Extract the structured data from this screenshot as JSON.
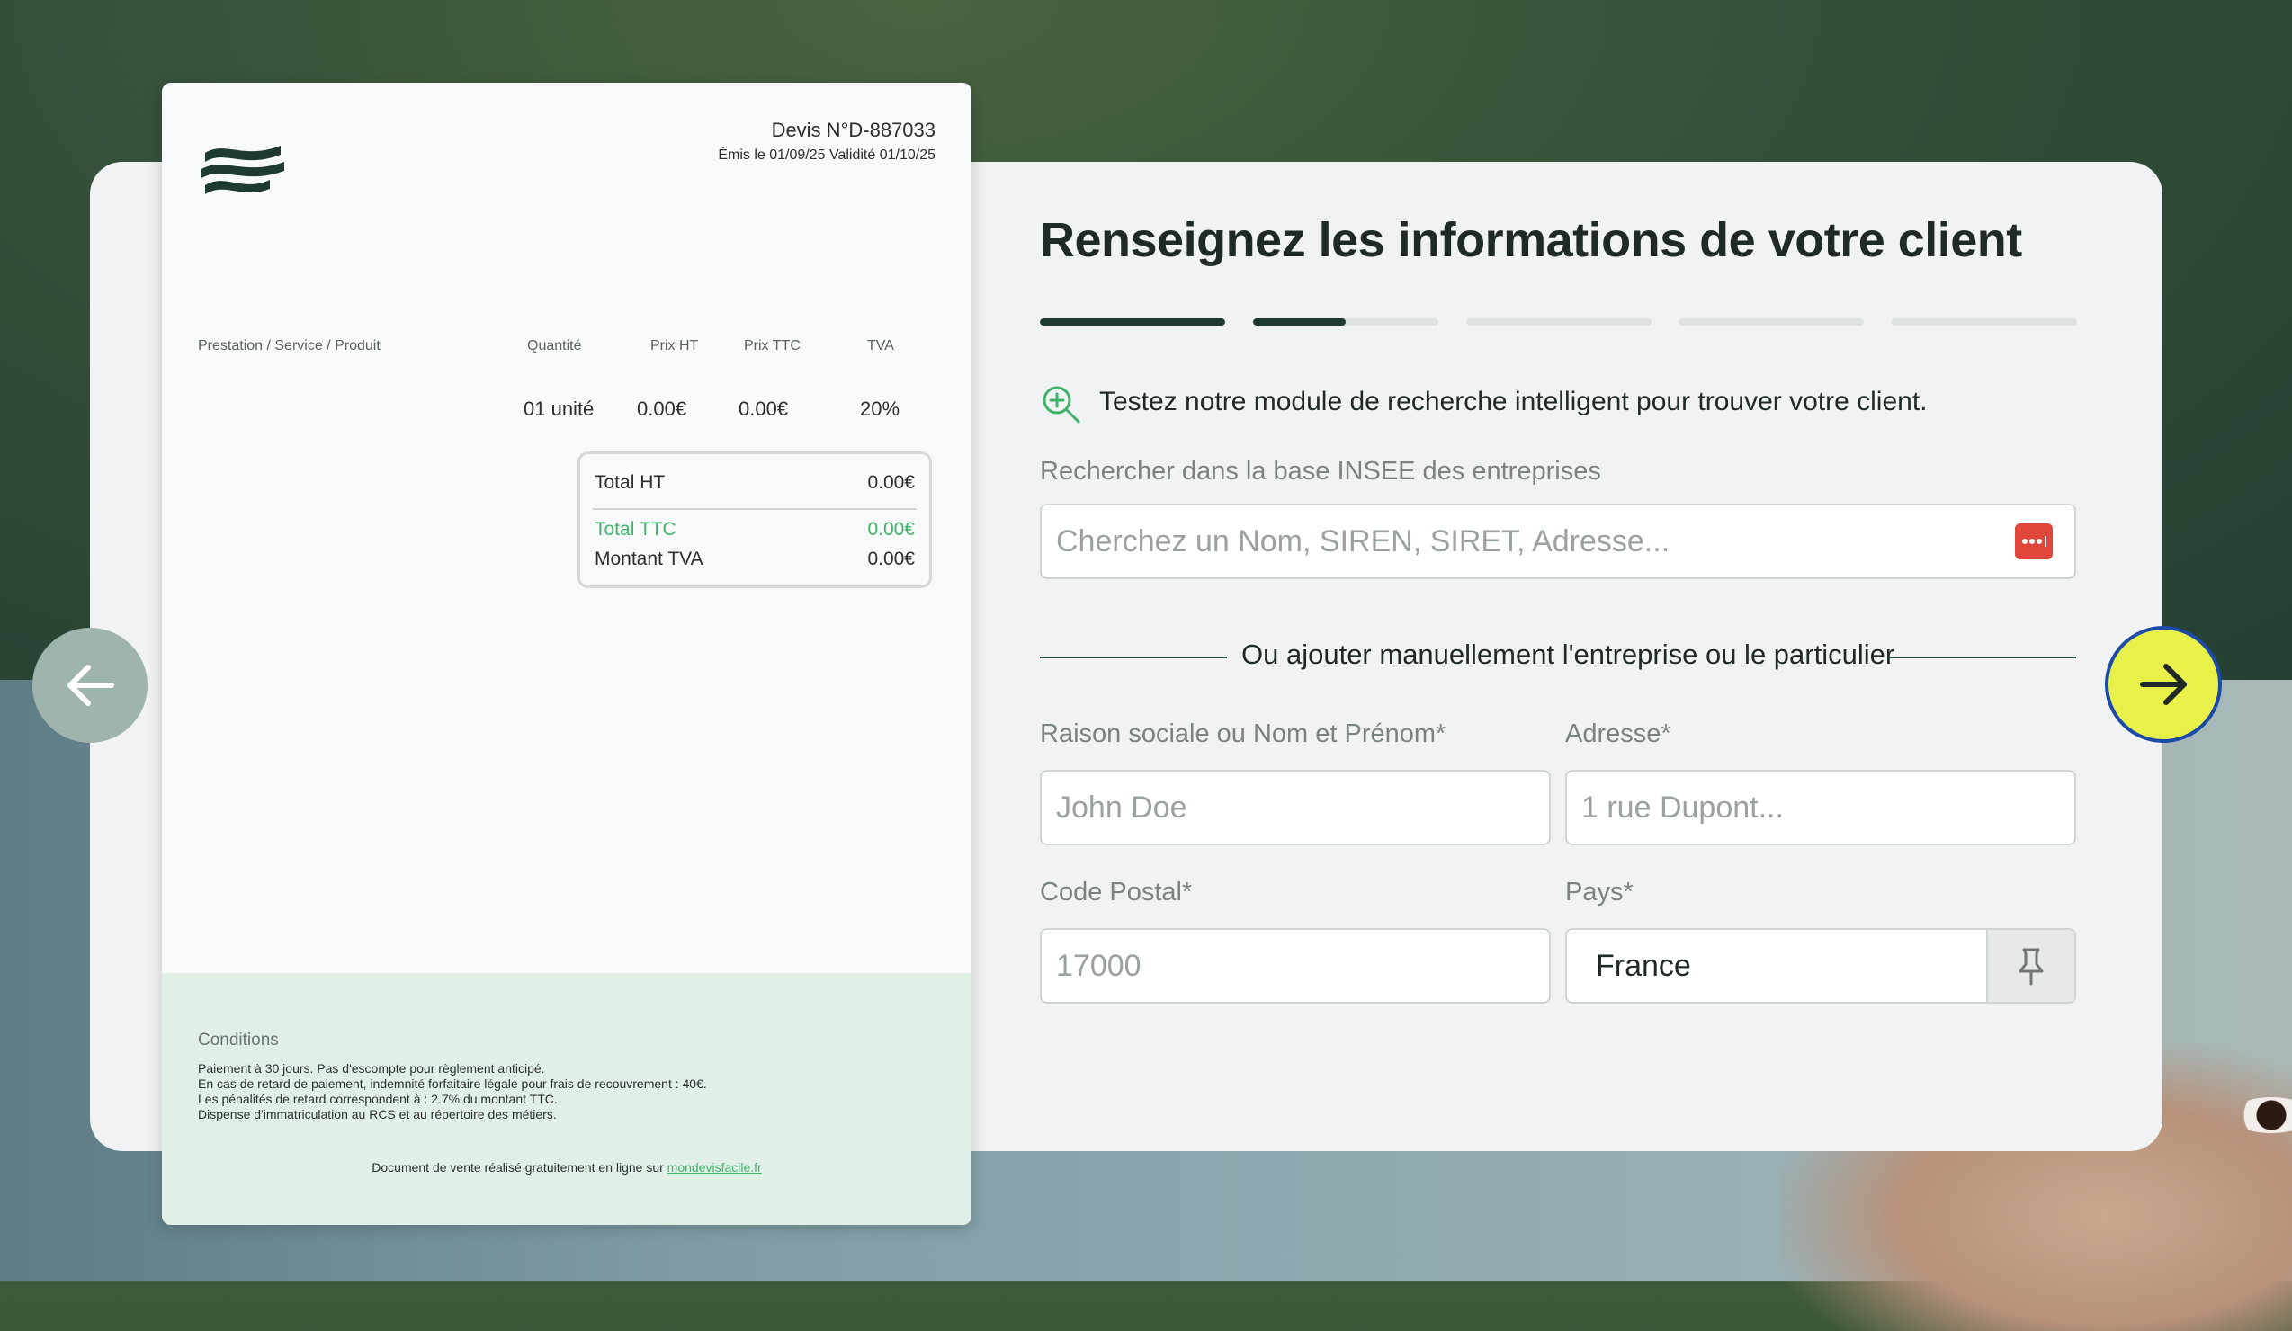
{
  "document": {
    "devis_number": "Devis N°D-887033",
    "dates": "Émis le 01/09/25 Validité 01/10/25",
    "columns": [
      "Prestation / Service / Produit",
      "Quantité",
      "Prix HT",
      "Prix TTC",
      "TVA"
    ],
    "row": {
      "quantity": "01 unité",
      "prix_ht": "0.00€",
      "prix_ttc": "0.00€",
      "tva": "20%"
    },
    "totals": {
      "total_ht_label": "Total HT",
      "total_ht_value": "0.00€",
      "total_ttc_label": "Total TTC",
      "total_ttc_value": "0.00€",
      "montant_tva_label": "Montant TVA",
      "montant_tva_value": "0.00€"
    },
    "conditions_title": "Conditions",
    "conditions": [
      "Paiement à 30 jours. Pas d'escompte pour règlement anticipé.",
      "En cas de retard de paiement, indemnité forfaitaire légale pour frais de recouvrement : 40€.",
      "Les pénalités de retard correspondent à : 2.7% du montant TTC.",
      "Dispense d'immatriculation au RCS et au répertoire des métiers."
    ],
    "footer_note": "Document de vente réalisé gratuitement en ligne sur ",
    "footer_link": "mondevisfacile.fr"
  },
  "form": {
    "title": "Renseignez les informations de votre client",
    "steps_progress": [
      1.0,
      0.5,
      0,
      0,
      0
    ],
    "hint": "Testez notre module de recherche intelligent pour trouver votre client.",
    "search_label": "Rechercher dans la base INSEE des entreprises",
    "search_placeholder": "Cherchez un Nom, SIREN, SIRET, Adresse...",
    "divider": "Ou ajouter manuellement l'entreprise ou le particulier",
    "name_label": "Raison sociale ou Nom et Prénom*",
    "name_placeholder": "John Doe",
    "address_label": "Adresse*",
    "address_placeholder": "1 rue Dupont...",
    "postal_label": "Code Postal*",
    "postal_placeholder": "17000",
    "country_label": "Pays*",
    "country_value": "France"
  },
  "colors": {
    "accent_dark": "#1f3a30",
    "accent_green": "#3fb36a",
    "next_button": "#e8f04a"
  }
}
